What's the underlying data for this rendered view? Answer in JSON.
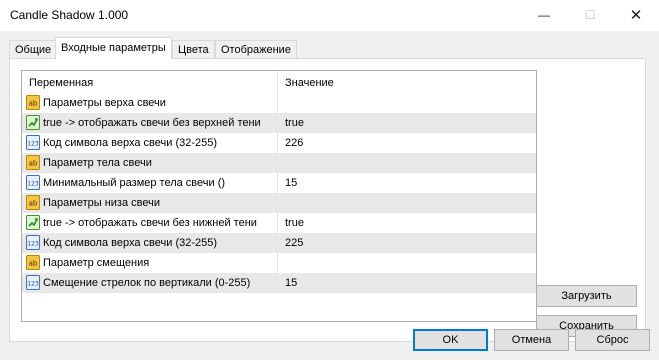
{
  "window": {
    "title": "Candle Shadow 1.000",
    "min_glyph": "—",
    "max_glyph": "☐",
    "close_glyph": "✕"
  },
  "tabs": [
    {
      "label": "Общие"
    },
    {
      "label": "Входные параметры",
      "active": true
    },
    {
      "label": "Цвета"
    },
    {
      "label": "Отображение"
    }
  ],
  "grid": {
    "col_variable": "Переменная",
    "col_value": "Значение",
    "rows": [
      {
        "icon": "string-icon",
        "name": "Параметры верха свечи",
        "value": ""
      },
      {
        "icon": "bool-icon",
        "name": "true -> отображать свечи без верхней тени",
        "value": "true"
      },
      {
        "icon": "int-icon",
        "name": "Код символа верха свечи (32-255)",
        "value": "226"
      },
      {
        "icon": "string-icon",
        "name": "Параметр тела свечи",
        "value": ""
      },
      {
        "icon": "int-icon",
        "name": "Минимальный размер тела свечи ()",
        "value": "15"
      },
      {
        "icon": "string-icon",
        "name": "Параметры низа свечи",
        "value": ""
      },
      {
        "icon": "bool-icon",
        "name": "true -> отображать свечи без нижней тени",
        "value": "true"
      },
      {
        "icon": "int-icon",
        "name": "Код символа верха свечи (32-255)",
        "value": "225"
      },
      {
        "icon": "string-icon",
        "name": "Параметр смещения",
        "value": ""
      },
      {
        "icon": "int-icon",
        "name": "Смещение стрелок по вертикали (0-255)",
        "value": "15"
      }
    ]
  },
  "side_buttons": {
    "load": "Загрузить",
    "save": "Сохранить"
  },
  "footer": {
    "ok": "OK",
    "cancel": "Отмена",
    "reset": "Сброс"
  },
  "icon_text": {
    "string": "ab",
    "int": "123"
  },
  "colors": {
    "accent": "#0078d7",
    "row_alt": "#e8e8e8",
    "dialog_bg": "#f0f0f0"
  }
}
